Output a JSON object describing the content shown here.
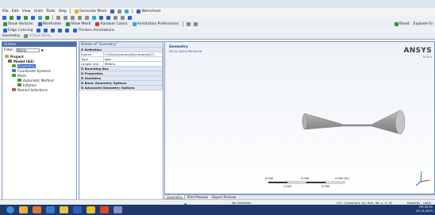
{
  "menubar": {
    "items": [
      "File",
      "Edit",
      "View",
      "Units",
      "Tools",
      "Help"
    ],
    "generate_mesh_label": "Generate Mesh",
    "worksheet_label": "Worksheet"
  },
  "toolbar2": {
    "show_vertices": "Show Vertices",
    "wireframe": "Wireframe",
    "show_mesh": "Show Mesh",
    "random_colors": "Random Colors",
    "annotation_preferences": "Annotation Preferences",
    "reset": "Reset",
    "explode": "Explode Fa"
  },
  "toolbar3": {
    "edge_coloring": "Edge Coloring",
    "thicken_annotations": "Thicken Annotations"
  },
  "toolbar4": {
    "geometry": "Geometry",
    "virtual_body": "Virtual Body"
  },
  "outline": {
    "title": "Outline",
    "filter_label": "Filter:",
    "filter_value": "Name",
    "items": [
      {
        "label": "Project",
        "level": 0
      },
      {
        "label": "Model (A3)",
        "level": 1
      },
      {
        "label": "Geometry",
        "level": 2,
        "selected": true
      },
      {
        "label": "Coordinate Systems",
        "level": 2
      },
      {
        "label": "Mesh",
        "level": 2
      },
      {
        "label": "Automatic Method",
        "level": 3
      },
      {
        "label": "Inflation",
        "level": 3
      },
      {
        "label": "Named Selections",
        "level": 2
      }
    ]
  },
  "details": {
    "title": "Details of \"Geometry\"",
    "rows": [
      {
        "group": true,
        "label": "Definition"
      },
      {
        "label": "Source",
        "value": "C:\\Users\\Lenovo\\Documents\\CF..."
      },
      {
        "label": "Type",
        "value": "Iges"
      },
      {
        "label": "Length Unit",
        "value": "Meters"
      },
      {
        "group": true,
        "label": "Bounding Box"
      },
      {
        "group": true,
        "label": "Properties"
      },
      {
        "group": true,
        "label": "Statistics"
      },
      {
        "group": true,
        "label": "Basic Geometry Options"
      },
      {
        "group": true,
        "label": "Advanced Geometry Options"
      }
    ]
  },
  "graphics": {
    "title": "Geometry",
    "date": "29-11-2015 PM 05:59",
    "logo": "ANSYS",
    "version": "R16.0",
    "scale": {
      "l0": "0.000",
      "l1": "2.000",
      "l2": "4.000 (m)",
      "m1": "1.000",
      "m2": "3.000"
    }
  },
  "tabs": [
    "Geometry",
    "Print Preview",
    "Report Preview"
  ],
  "status": {
    "messages": "2 Messages",
    "selection": "No Selection",
    "units": "U.S. Customary (in, lbm, lbf, s, V, A)",
    "angle": "Degrees",
    "rate": "rad/s"
  },
  "taskbar": {
    "clock_time": "PM 05:59",
    "clock_date": "29-11-2015"
  }
}
